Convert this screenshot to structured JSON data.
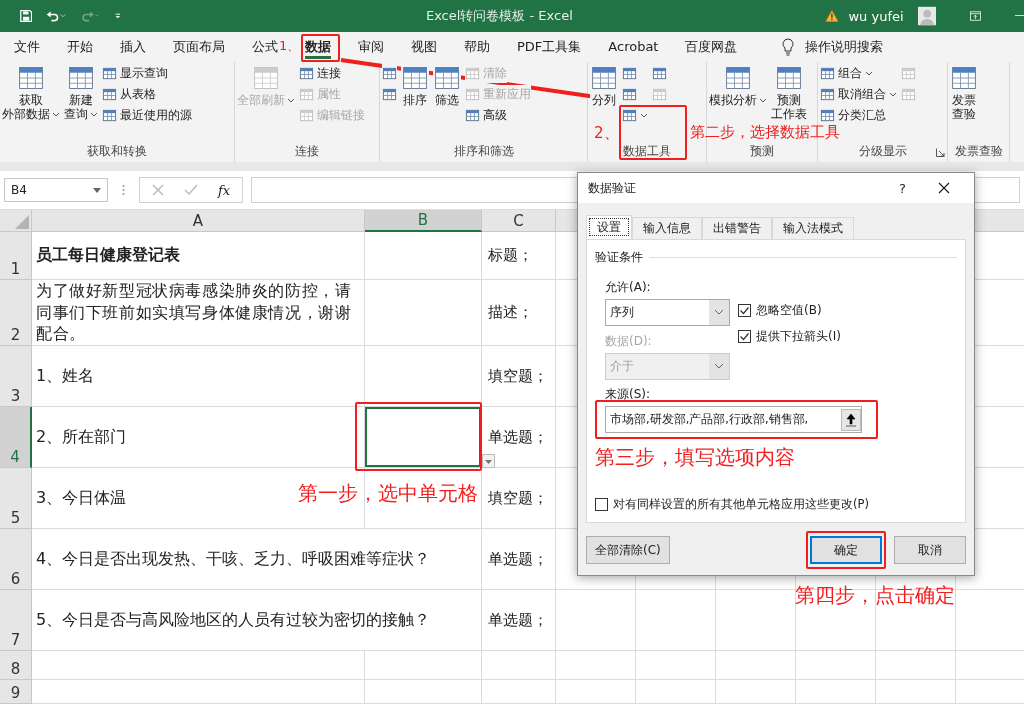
{
  "title_bar": {
    "title": "Excel转问卷模板  -  Excel",
    "user": "wu yufei"
  },
  "ribbon_tabs": [
    {
      "label": "文件",
      "selected": false
    },
    {
      "label": "开始",
      "selected": false
    },
    {
      "label": "插入",
      "selected": false
    },
    {
      "label": "页面布局",
      "selected": false
    },
    {
      "label": "公式",
      "selected": false
    },
    {
      "label": "数据",
      "selected": true
    },
    {
      "label": "审阅",
      "selected": false
    },
    {
      "label": "视图",
      "selected": false
    },
    {
      "label": "帮助",
      "selected": false
    },
    {
      "label": "PDF工具集",
      "selected": false
    },
    {
      "label": "Acrobat",
      "selected": false
    },
    {
      "label": "百度网盘",
      "selected": false
    }
  ],
  "tell_me": "操作说明搜索",
  "ribbon_groups": [
    {
      "label": "获取和转换",
      "launcher": false,
      "items": [
        {
          "label": [
            "获取",
            "外部数据"
          ],
          "kind": "large",
          "dropdown": true,
          "disabled": false
        },
        {
          "label": [
            "新建",
            "查询"
          ],
          "kind": "large",
          "dropdown": true,
          "disabled": false
        },
        {
          "label": "显示查询",
          "kind": "small",
          "dropdown": false,
          "disabled": false
        },
        {
          "label": "从表格",
          "kind": "small",
          "dropdown": false,
          "disabled": false
        },
        {
          "label": "最近使用的源",
          "kind": "small",
          "dropdown": false,
          "disabled": false
        }
      ]
    },
    {
      "label": "连接",
      "launcher": false,
      "items": [
        {
          "label": [
            "全部刷新"
          ],
          "kind": "large",
          "dropdown": true,
          "disabled": true
        },
        {
          "label": "连接",
          "kind": "small",
          "dropdown": false,
          "disabled": false
        },
        {
          "label": "属性",
          "kind": "small",
          "dropdown": false,
          "disabled": true
        },
        {
          "label": "编辑链接",
          "kind": "small",
          "dropdown": false,
          "disabled": true
        }
      ]
    },
    {
      "label": "排序和筛选",
      "launcher": false,
      "items": [
        {
          "kind": "icon",
          "dropdown": false,
          "disabled": false
        },
        {
          "kind": "icon",
          "dropdown": false,
          "disabled": false
        },
        {
          "label": [
            "排序"
          ],
          "kind": "large",
          "dropdown": false,
          "disabled": false
        },
        {
          "label": [
            "筛选"
          ],
          "kind": "large",
          "dropdown": false,
          "disabled": false
        },
        {
          "label": "清除",
          "kind": "small",
          "dropdown": false,
          "disabled": true
        },
        {
          "label": "重新应用",
          "kind": "small",
          "dropdown": false,
          "disabled": true
        },
        {
          "label": "高级",
          "kind": "small",
          "dropdown": false,
          "disabled": false
        }
      ]
    },
    {
      "label": "数据工具",
      "launcher": false,
      "items": [
        {
          "label": [
            "分列"
          ],
          "kind": "large",
          "dropdown": false,
          "disabled": false
        },
        {
          "kind": "icon",
          "dropdown": false,
          "disabled": false
        },
        {
          "kind": "icon",
          "dropdown": false,
          "disabled": false
        },
        {
          "kind": "icon",
          "dropdown": true,
          "disabled": false
        },
        {
          "kind": "icon",
          "dropdown": false,
          "disabled": false
        },
        {
          "kind": "icon",
          "dropdown": false,
          "disabled": true
        }
      ]
    },
    {
      "label": "预测",
      "launcher": false,
      "items": [
        {
          "label": [
            "模拟分析"
          ],
          "kind": "large",
          "dropdown": true,
          "disabled": false
        },
        {
          "label": [
            "预测",
            "工作表"
          ],
          "kind": "large",
          "dropdown": false,
          "disabled": false
        }
      ]
    },
    {
      "label": "分级显示",
      "launcher": true,
      "items": [
        {
          "label": "组合",
          "kind": "small",
          "dropdown": true,
          "disabled": false
        },
        {
          "label": "取消组合",
          "kind": "small",
          "dropdown": true,
          "disabled": false
        },
        {
          "label": "分类汇总",
          "kind": "small",
          "dropdown": false,
          "disabled": false
        },
        {
          "kind": "icon",
          "dropdown": false,
          "disabled": true
        },
        {
          "kind": "icon",
          "dropdown": false,
          "disabled": true
        }
      ]
    },
    {
      "label": "发票查验",
      "launcher": false,
      "items": [
        {
          "label": [
            "发票",
            "查验"
          ],
          "kind": "large",
          "dropdown": false,
          "disabled": false
        }
      ]
    }
  ],
  "name_box": "B4",
  "function_label": "fx",
  "columns": [
    {
      "label": "A",
      "selected": false
    },
    {
      "label": "B",
      "selected": true
    },
    {
      "label": "C",
      "selected": false
    }
  ],
  "rows": [
    {
      "number": "1",
      "a": "员工每日健康登记表",
      "c": "标题；",
      "bold": true,
      "wrap": false,
      "selected": false
    },
    {
      "number": "2",
      "a": "为了做好新型冠状病毒感染肺炎的防控，请同事们下班前如实填写身体健康情况，谢谢配合。",
      "c": "描述；",
      "bold": false,
      "wrap": true,
      "selected": false
    },
    {
      "number": "3",
      "a": "1、姓名",
      "c": "填空题；",
      "bold": false,
      "wrap": false,
      "selected": false
    },
    {
      "number": "4",
      "a": "2、所在部门",
      "c": "单选题；",
      "bold": false,
      "wrap": false,
      "selected": true
    },
    {
      "number": "5",
      "a": "3、今日体温",
      "c": "填空题；",
      "bold": false,
      "wrap": false,
      "selected": false
    },
    {
      "number": "6",
      "a": "4、今日是否出现发热、干咳、乏力、呼吸困难等症状？",
      "c": "单选题；",
      "bold": false,
      "wrap": false,
      "selected": false
    },
    {
      "number": "7",
      "a": "5、今日是否与高风险地区的人员有过较为密切的接触？",
      "c": "单选题；",
      "bold": false,
      "wrap": false,
      "selected": false
    },
    {
      "number": "8",
      "selected": false
    },
    {
      "number": "9",
      "selected": false
    }
  ],
  "dialog": {
    "title": "数据验证",
    "help": "?",
    "tabs": [
      {
        "label": "设置",
        "selected": true
      },
      {
        "label": "输入信息",
        "selected": false
      },
      {
        "label": "出错警告",
        "selected": false
      },
      {
        "label": "输入法模式",
        "selected": false
      }
    ],
    "section": "验证条件",
    "allow": {
      "label": "允许(A):",
      "value": "序列",
      "disabled": false
    },
    "data": {
      "label": "数据(D):",
      "value": "介于",
      "disabled": true
    },
    "checkboxes": [
      {
        "label": "忽略空值(B)",
        "checked": true
      },
      {
        "label": "提供下拉箭头(I)",
        "checked": true
      }
    ],
    "source": {
      "label": "来源(S):",
      "value": "市场部,研发部,产品部,行政部,销售部,"
    },
    "apply_all": {
      "label": "对有同样设置的所有其他单元格应用这些更改(P)",
      "checked": false
    },
    "buttons": [
      {
        "label": "全部清除(C)",
        "default": false
      },
      {
        "label": "确定",
        "default": true
      },
      {
        "label": "取消",
        "default": false
      }
    ]
  },
  "annotations": [
    "1、",
    "2、",
    "第二步，选择数据工具",
    "第三步，填写选项内容",
    "第一步，选中单元格",
    "第四步，点击确定"
  ]
}
